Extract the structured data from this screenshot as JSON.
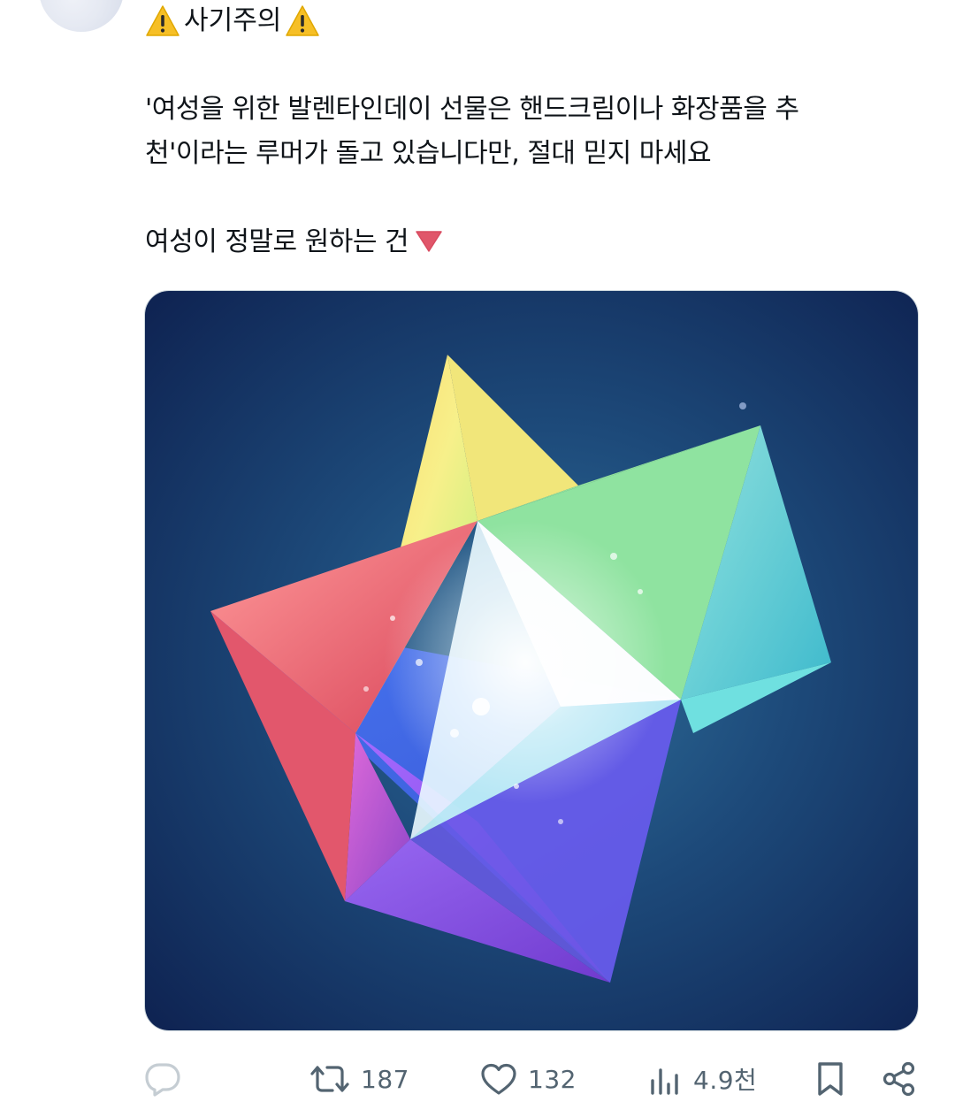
{
  "post": {
    "title": "사기주의",
    "body_lines": [
      "'여성을 위한 발렌타인데이 선물은 핸드크림이나 화장품을 추",
      "천'이라는 루머가 돌고 있습니다만,  절대 믿지 마세요",
      "여성이 정말로 원하는 건"
    ]
  },
  "actions": {
    "reply": {
      "icon": "reply-icon"
    },
    "repost": {
      "icon": "repost-icon",
      "count": "187"
    },
    "like": {
      "icon": "heart-icon",
      "count": "132"
    },
    "views": {
      "icon": "views-icon",
      "count": "4.9천"
    },
    "bookmark": {
      "icon": "bookmark-icon"
    },
    "share": {
      "icon": "share-icon"
    }
  },
  "colors": {
    "text": "#0f1419",
    "muted": "#536471",
    "warning": "#f4b400",
    "triangle": "#e0566a"
  }
}
